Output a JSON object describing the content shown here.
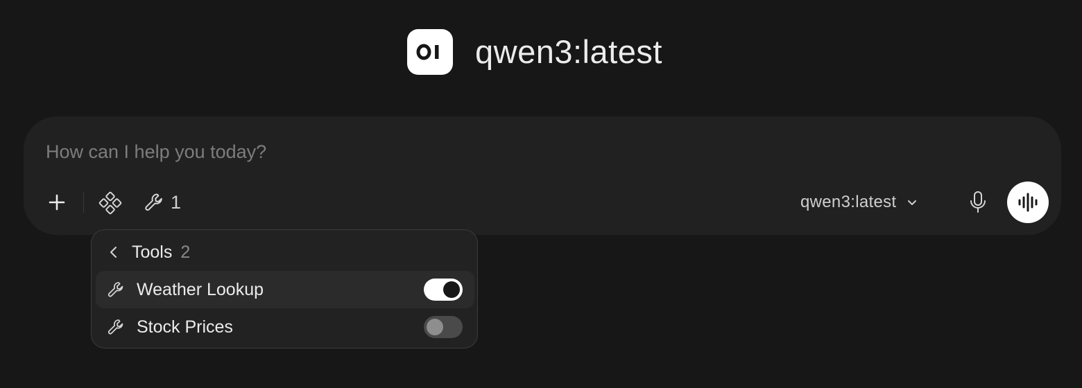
{
  "header": {
    "logo_text": "OI",
    "model_title": "qwen3:latest"
  },
  "composer": {
    "placeholder": "How can I help you today?",
    "value": "",
    "add_icon": "plus-icon",
    "integrations_icon": "integrations-icon",
    "tools_icon": "wrench-icon",
    "tools_enabled_count": "1",
    "model_selector_label": "qwen3:latest",
    "model_selector_icon": "chevron-down-icon",
    "mic_icon": "microphone-icon",
    "voice_icon": "waveform-icon"
  },
  "tools_menu": {
    "back_icon": "chevron-left-icon",
    "title": "Tools",
    "count": "2",
    "items": [
      {
        "label": "Weather Lookup",
        "icon": "wrench-icon",
        "enabled": true
      },
      {
        "label": "Stock Prices",
        "icon": "wrench-icon",
        "enabled": false
      }
    ]
  },
  "colors": {
    "background": "#171717",
    "composer": "#212121",
    "menu": "#222222",
    "toggle_on": "#ffffff",
    "toggle_off": "#4a4a4a"
  }
}
